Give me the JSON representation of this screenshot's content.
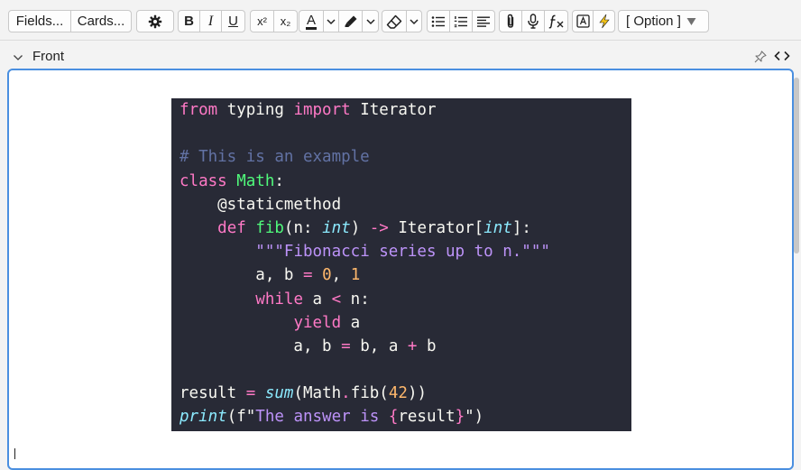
{
  "toolbar": {
    "fields_label": "Fields...",
    "cards_label": "Cards...",
    "bold_label": "B",
    "italic_label": "I",
    "underline_label": "U",
    "superscript_label": "x²",
    "subscript_label": "x₂",
    "text_color_label": "A",
    "option_select": "[ Option ]",
    "text_color": "#202020",
    "highlight_accent": "#f5c518"
  },
  "field": {
    "label": "Front"
  },
  "editor": {
    "accent": "#4a8fe0",
    "code_background": "#282a36",
    "code_lines": [
      [
        {
          "t": "from",
          "c": "kw"
        },
        {
          "t": " typing ",
          "c": ""
        },
        {
          "t": "import",
          "c": "kw"
        },
        {
          "t": " Iterator",
          "c": ""
        }
      ],
      [],
      [
        {
          "t": "# This is an example",
          "c": "cm"
        }
      ],
      [
        {
          "t": "class",
          "c": "kw"
        },
        {
          "t": " ",
          "c": ""
        },
        {
          "t": "Math",
          "c": "cls"
        },
        {
          "t": ":",
          "c": ""
        }
      ],
      [
        {
          "t": "    @staticmethod",
          "c": ""
        }
      ],
      [
        {
          "t": "    ",
          "c": ""
        },
        {
          "t": "def",
          "c": "kw"
        },
        {
          "t": " ",
          "c": ""
        },
        {
          "t": "fib",
          "c": "cls"
        },
        {
          "t": "(n: ",
          "c": ""
        },
        {
          "t": "int",
          "c": "ty"
        },
        {
          "t": ") ",
          "c": ""
        },
        {
          "t": "->",
          "c": "op"
        },
        {
          "t": " Iterator[",
          "c": ""
        },
        {
          "t": "int",
          "c": "ty"
        },
        {
          "t": "]:",
          "c": ""
        }
      ],
      [
        {
          "t": "        ",
          "c": ""
        },
        {
          "t": "\"\"\"Fibonacci series up to n.\"\"\"",
          "c": "st"
        }
      ],
      [
        {
          "t": "        a, b ",
          "c": ""
        },
        {
          "t": "=",
          "c": "op"
        },
        {
          "t": " ",
          "c": ""
        },
        {
          "t": "0",
          "c": "nm"
        },
        {
          "t": ", ",
          "c": ""
        },
        {
          "t": "1",
          "c": "nm"
        }
      ],
      [
        {
          "t": "        ",
          "c": ""
        },
        {
          "t": "while",
          "c": "kw"
        },
        {
          "t": " a ",
          "c": ""
        },
        {
          "t": "<",
          "c": "op"
        },
        {
          "t": " n:",
          "c": ""
        }
      ],
      [
        {
          "t": "            ",
          "c": ""
        },
        {
          "t": "yield",
          "c": "kw"
        },
        {
          "t": " a",
          "c": ""
        }
      ],
      [
        {
          "t": "            a, b ",
          "c": ""
        },
        {
          "t": "=",
          "c": "op"
        },
        {
          "t": " b, a ",
          "c": ""
        },
        {
          "t": "+",
          "c": "op"
        },
        {
          "t": " b",
          "c": ""
        }
      ],
      [],
      [
        {
          "t": "result ",
          "c": ""
        },
        {
          "t": "=",
          "c": "op"
        },
        {
          "t": " ",
          "c": ""
        },
        {
          "t": "sum",
          "c": "bi"
        },
        {
          "t": "(Math",
          "c": ""
        },
        {
          "t": ".",
          "c": "op"
        },
        {
          "t": "fib(",
          "c": ""
        },
        {
          "t": "42",
          "c": "nm"
        },
        {
          "t": "))",
          "c": ""
        }
      ],
      [
        {
          "t": "print",
          "c": "bi"
        },
        {
          "t": "(f\"",
          "c": ""
        },
        {
          "t": "The answer is ",
          "c": "st"
        },
        {
          "t": "{",
          "c": "op"
        },
        {
          "t": "result",
          "c": ""
        },
        {
          "t": "}",
          "c": "op"
        },
        {
          "t": "\")",
          "c": ""
        }
      ]
    ]
  }
}
